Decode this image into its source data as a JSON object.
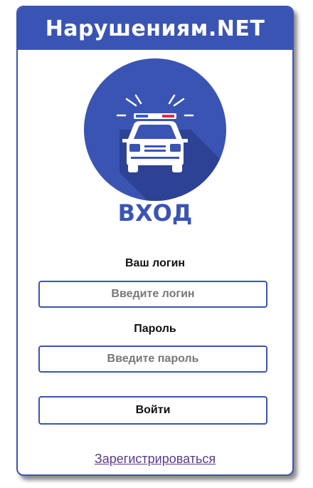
{
  "header": {
    "title": "Нарушениям.NET"
  },
  "logo": {
    "icon": "police-car-icon",
    "circle_color": "#3a54b4"
  },
  "page_title": "ВХОД",
  "login": {
    "label": "Ваш логин",
    "placeholder": "Введите логин"
  },
  "password": {
    "label": "Пароль",
    "placeholder": "Введите пароль"
  },
  "submit_label": "Войти",
  "register_link": "Зарегистрироваться",
  "colors": {
    "accent": "#3a54b4",
    "link": "#5a3a8a",
    "siren_blue": "#2e5fd6",
    "siren_red": "#e03040"
  }
}
